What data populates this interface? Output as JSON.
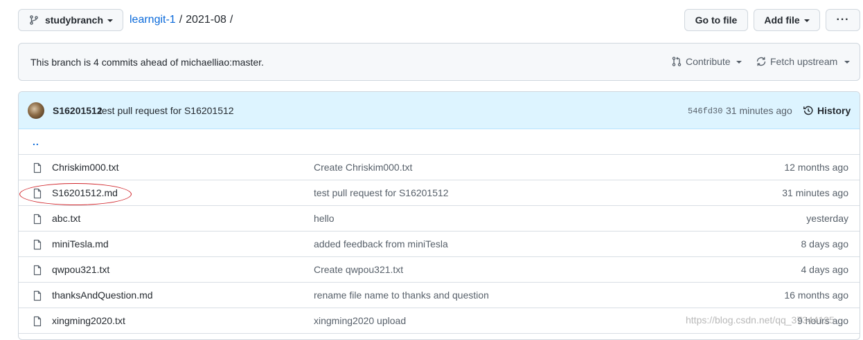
{
  "branch": {
    "name": "studybranch",
    "icon": "git-branch-icon"
  },
  "breadcrumb": {
    "repo": "learngit-1",
    "sep1": "/",
    "folder": "2021-08",
    "sep2": "/"
  },
  "actions": {
    "go_to_file": "Go to file",
    "add_file": "Add file",
    "more": "···"
  },
  "ahead": {
    "text": "This branch is 4 commits ahead of michaelliao:master.",
    "contribute": "Contribute",
    "fetch_upstream": "Fetch upstream"
  },
  "latest_commit": {
    "author": "S16201512",
    "message": "test pull request for S16201512",
    "sha": "546fd30",
    "time": "31 minutes ago",
    "history_label": "History"
  },
  "parent_dir": "..",
  "files": [
    {
      "name": "Chriskim000.txt",
      "message": "Create Chriskim000.txt",
      "age": "12 months ago"
    },
    {
      "name": "S16201512.md",
      "message": "test pull request for S16201512",
      "age": "31 minutes ago"
    },
    {
      "name": "abc.txt",
      "message": "hello",
      "age": "yesterday"
    },
    {
      "name": "miniTesla.md",
      "message": "added feedback from miniTesla",
      "age": "8 days ago"
    },
    {
      "name": "qwpou321.txt",
      "message": "Create qwpou321.txt",
      "age": "4 days ago"
    },
    {
      "name": "thanksAndQuestion.md",
      "message": "rename file name to thanks and question",
      "age": "16 months ago"
    },
    {
      "name": "xingming2020.txt",
      "message": "xingming2020 upload",
      "age": "9 hours ago"
    }
  ],
  "watermark": "https://blog.csdn.net/qq_37344125",
  "colors": {
    "link": "#0969da",
    "commit_bar": "#ddf4ff",
    "annotation": "#d0242a"
  }
}
